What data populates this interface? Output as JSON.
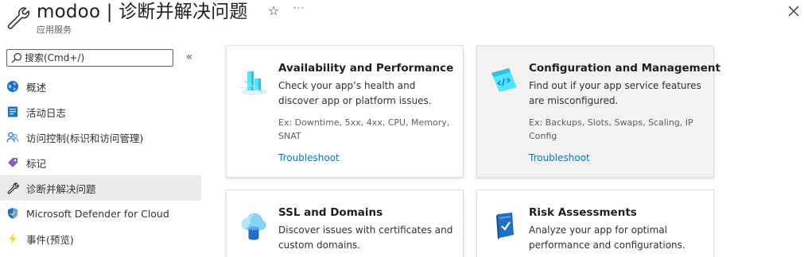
{
  "header": {
    "title": "modoo | 诊断并解决问题",
    "subtitle": "应用服务",
    "star_icon": "star-icon",
    "more_label": "···",
    "close_icon": "close-icon"
  },
  "sidebar": {
    "search": {
      "placeholder": "搜索(Cmd+/)",
      "value": ""
    },
    "collapse_label": "«",
    "items": [
      {
        "label": "概述",
        "icon": "overview-globe-icon"
      },
      {
        "label": "活动日志",
        "icon": "activity-log-icon"
      },
      {
        "label": "访问控制(标识和访问管理)",
        "icon": "people-icon"
      },
      {
        "label": "标记",
        "icon": "tag-icon"
      },
      {
        "label": "诊断并解决问题",
        "icon": "wrench-icon",
        "active": true
      },
      {
        "label": "Microsoft Defender for Cloud",
        "icon": "shield-icon"
      },
      {
        "label": "事件(预览)",
        "icon": "lightning-icon"
      }
    ]
  },
  "cards": [
    {
      "title": "Availability and Performance",
      "description": "Check your app’s health and discover app or platform issues.",
      "examples": "Ex: Downtime, 5xx, 4xx, CPU, Memory, SNAT",
      "link": "Troubleshoot",
      "icon": "availability-chart-icon"
    },
    {
      "title": "Configuration and Management",
      "description": "Find out if your app service features are misconfigured.",
      "examples": "Ex: Backups, Slots, Swaps, Scaling, IP Config",
      "link": "Troubleshoot",
      "icon": "code-window-icon"
    },
    {
      "title": "SSL and Domains",
      "description": "Discover issues with certificates and custom domains.",
      "icon": "cloud-database-icon"
    },
    {
      "title": "Risk Assessments",
      "description": "Analyze your app for optimal performance and configurations.",
      "icon": "book-check-icon"
    }
  ]
}
